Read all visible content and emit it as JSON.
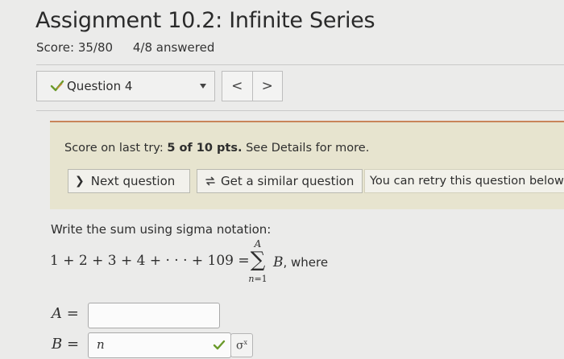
{
  "header": {
    "title": "Assignment 10.2: Infinite Series",
    "score": "Score: 35/80",
    "answered": "4/8 answered"
  },
  "question_nav": {
    "selected": "Question 4",
    "prev_label": "<",
    "next_label": ">"
  },
  "feedback": {
    "prefix": "Score on last try: ",
    "score": "5 of 10 pts.",
    "suffix": " See Details for more.",
    "next_button": "Next question",
    "similar_button": "Get a similar question",
    "retry_note": "You can retry this question below"
  },
  "problem": {
    "prompt": "Write the sum using sigma notation:",
    "expression": "1 + 2 + 3 + 4 + · · · + 109 =",
    "sigma_upper": "A",
    "sigma_symbol": "∑",
    "sigma_lower_var": "n",
    "sigma_lower_rest": "=1",
    "term": "B",
    "where": ", where"
  },
  "answers": {
    "a_label": "A",
    "b_label": "B",
    "equals": " =",
    "a_value": "",
    "b_value": "n"
  },
  "colors": {
    "panel_bg": "#e7e4cf",
    "panel_border": "#c8845a",
    "check_green": "#6a9a2a"
  },
  "icons": {
    "question_status": "check-pencil-icon",
    "dropdown": "caret-down-icon",
    "next": "chevron-right-icon",
    "similar": "retry-arrows-icon",
    "answer_ok": "checkmark-icon",
    "format": "superscript-format-icon"
  }
}
